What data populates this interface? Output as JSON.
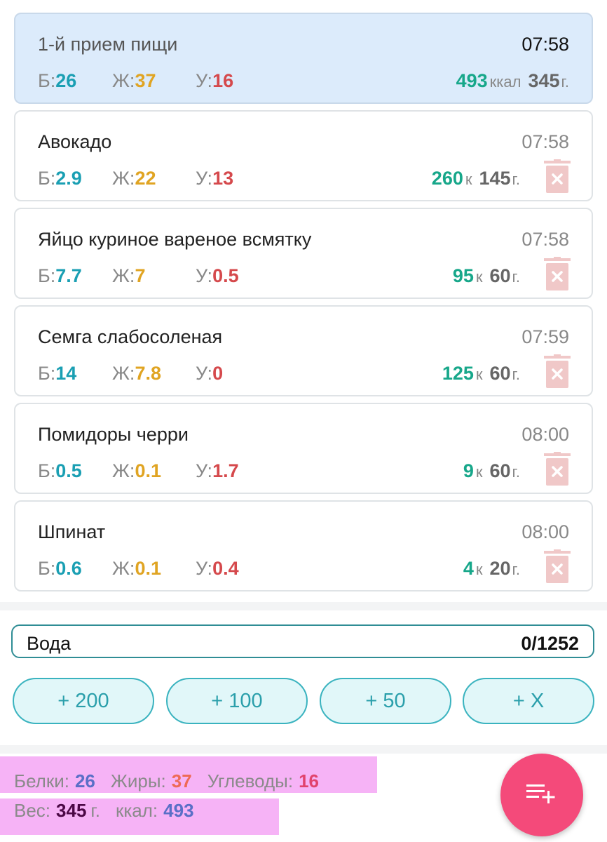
{
  "meal_summary": {
    "name": "1-й прием пищи",
    "time": "07:58",
    "protein_label": "Б:",
    "protein": "26",
    "fat_label": "Ж:",
    "fat": "37",
    "carbs_label": "У:",
    "carbs": "16",
    "kcal": "493",
    "kcal_unit": "ккал",
    "weight": "345",
    "weight_unit": "г."
  },
  "food_items": [
    {
      "name": "Авокадо",
      "time": "07:58",
      "protein_label": "Б:",
      "protein": "2.9",
      "fat_label": "Ж:",
      "fat": "22",
      "carbs_label": "У:",
      "carbs": "13",
      "kcal": "260",
      "kcal_unit": "к",
      "weight": "145",
      "weight_unit": "г."
    },
    {
      "name": "Яйцо куриное вареное всмятку",
      "time": "07:58",
      "protein_label": "Б:",
      "protein": "7.7",
      "fat_label": "Ж:",
      "fat": "7",
      "carbs_label": "У:",
      "carbs": "0.5",
      "kcal": "95",
      "kcal_unit": "к",
      "weight": "60",
      "weight_unit": "г."
    },
    {
      "name": "Семга слабосоленая",
      "time": "07:59",
      "protein_label": "Б:",
      "protein": "14",
      "fat_label": "Ж:",
      "fat": "7.8",
      "carbs_label": "У:",
      "carbs": "0",
      "kcal": "125",
      "kcal_unit": "к",
      "weight": "60",
      "weight_unit": "г."
    },
    {
      "name": "Помидоры черри",
      "time": "08:00",
      "protein_label": "Б:",
      "protein": "0.5",
      "fat_label": "Ж:",
      "fat": "0.1",
      "carbs_label": "У:",
      "carbs": "1.7",
      "kcal": "9",
      "kcal_unit": "к",
      "weight": "60",
      "weight_unit": "г."
    },
    {
      "name": "Шпинат",
      "time": "08:00",
      "protein_label": "Б:",
      "protein": "0.6",
      "fat_label": "Ж:",
      "fat": "0.1",
      "carbs_label": "У:",
      "carbs": "0.4",
      "kcal": "4",
      "kcal_unit": "к",
      "weight": "20",
      "weight_unit": "г."
    }
  ],
  "water": {
    "label": "Вода",
    "value": "0/1252",
    "buttons": [
      "+ 200",
      "+ 100",
      "+ 50",
      "+ X"
    ]
  },
  "totals": {
    "protein_label": "Белки:",
    "protein": "26",
    "fat_label": "Жиры:",
    "fat": "37",
    "carbs_label": "Углеводы:",
    "carbs": "16",
    "weight_label": "Вес:",
    "weight": "345",
    "weight_unit": "г.",
    "kcal_label": "ккал:",
    "kcal": "493"
  },
  "icons": {
    "delete": "trash-icon",
    "add_food": "playlist-add-icon"
  },
  "colors": {
    "protein": "#1a9fb3",
    "fat": "#e0a422",
    "carbs": "#d5494c",
    "kcal": "#17a78a",
    "fab": "#f44a7a",
    "highlight": "#f6b3f6"
  }
}
